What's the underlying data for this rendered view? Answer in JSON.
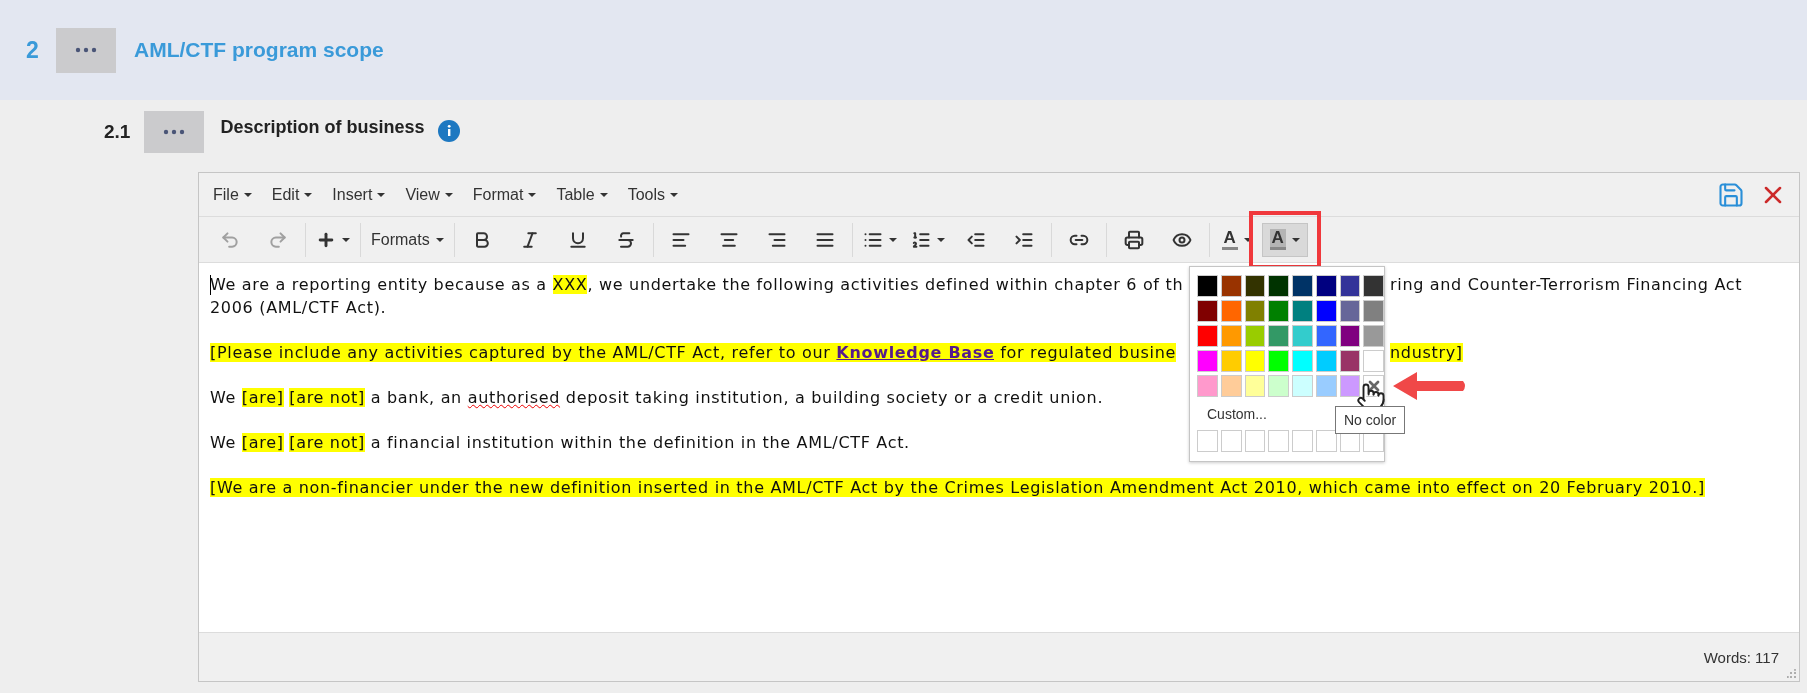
{
  "section": {
    "number": "2",
    "title": "AML/CTF program scope"
  },
  "subsection": {
    "number": "2.1",
    "title": "Description of business"
  },
  "editor": {
    "menus": [
      "File",
      "Edit",
      "Insert",
      "View",
      "Format",
      "Table",
      "Tools"
    ],
    "toolbar": [
      {
        "buttons": [
          {
            "kind": "undo",
            "disabled": true,
            "dropdown": false,
            "pressed": false
          },
          {
            "kind": "redo",
            "disabled": true,
            "dropdown": false,
            "pressed": false
          }
        ]
      },
      {
        "buttons": [
          {
            "kind": "insert",
            "disabled": false,
            "dropdown": true,
            "pressed": false
          }
        ]
      },
      {
        "buttons": [
          {
            "kind": "text",
            "label": "Formats",
            "disabled": false,
            "dropdown": true,
            "pressed": false
          }
        ]
      },
      {
        "buttons": [
          {
            "kind": "bold",
            "disabled": false,
            "dropdown": false,
            "pressed": false
          },
          {
            "kind": "italic",
            "disabled": false,
            "dropdown": false,
            "pressed": false
          },
          {
            "kind": "underline",
            "disabled": false,
            "dropdown": false,
            "pressed": false
          },
          {
            "kind": "strikethrough",
            "disabled": false,
            "dropdown": false,
            "pressed": false
          }
        ]
      },
      {
        "buttons": [
          {
            "kind": "align-left",
            "disabled": false,
            "dropdown": false,
            "pressed": false
          },
          {
            "kind": "align-center",
            "disabled": false,
            "dropdown": false,
            "pressed": false
          },
          {
            "kind": "align-right",
            "disabled": false,
            "dropdown": false,
            "pressed": false
          },
          {
            "kind": "justify",
            "disabled": false,
            "dropdown": false,
            "pressed": false
          }
        ]
      },
      {
        "buttons": [
          {
            "kind": "bullet-list",
            "disabled": false,
            "dropdown": true,
            "pressed": false
          },
          {
            "kind": "numbered-list",
            "disabled": false,
            "dropdown": true,
            "pressed": false
          },
          {
            "kind": "outdent",
            "disabled": false,
            "dropdown": false,
            "pressed": false
          },
          {
            "kind": "indent",
            "disabled": false,
            "dropdown": false,
            "pressed": false
          }
        ]
      },
      {
        "buttons": [
          {
            "kind": "link",
            "disabled": false,
            "dropdown": false,
            "pressed": false
          }
        ]
      },
      {
        "buttons": [
          {
            "kind": "print",
            "disabled": false,
            "dropdown": false,
            "pressed": false
          },
          {
            "kind": "preview",
            "disabled": false,
            "dropdown": false,
            "pressed": false
          }
        ]
      },
      {
        "buttons": [
          {
            "kind": "text-color",
            "label": "A",
            "disabled": false,
            "dropdown": true,
            "pressed": false
          },
          {
            "kind": "background-color",
            "label": "A",
            "disabled": false,
            "dropdown": true,
            "pressed": true
          }
        ]
      }
    ],
    "paragraphs": [
      {
        "lines": [
          [
            {
              "kind": "text",
              "text": "We are a reporting entity because as a "
            },
            {
              "kind": "mark",
              "text": "XXX"
            },
            {
              "kind": "text",
              "text": ", we undertake the following activities defined within chapter 6 of th"
            },
            {
              "kind": "covered"
            },
            {
              "kind": "text",
              "text": "ring and Counter-Terrorism Financing Act"
            }
          ],
          [
            {
              "kind": "text",
              "text": "2006 (AML/CTF Act)."
            }
          ]
        ]
      },
      {
        "lines": [
          [
            {
              "kind": "mark",
              "text": "[Please include any activities captured by the AML/CTF Act, refer to our "
            },
            {
              "kind": "link",
              "text": "Knowledge Base"
            },
            {
              "kind": "mark",
              "text": " for regulated busine"
            },
            {
              "kind": "covered"
            },
            {
              "kind": "mark",
              "text": "ndustry]"
            }
          ]
        ]
      },
      {
        "lines": [
          [
            {
              "kind": "text",
              "text": "We "
            },
            {
              "kind": "mark",
              "text": "[are]"
            },
            {
              "kind": "space"
            },
            {
              "kind": "mark",
              "text": "[are not]"
            },
            {
              "kind": "text",
              "text": " a bank, an "
            },
            {
              "kind": "misspelled",
              "text": "authorised"
            },
            {
              "kind": "text",
              "text": " deposit taking institution, a building society or a credit union."
            }
          ]
        ]
      },
      {
        "lines": [
          [
            {
              "kind": "text",
              "text": "We "
            },
            {
              "kind": "mark",
              "text": "[are]"
            },
            {
              "kind": "space"
            },
            {
              "kind": "mark",
              "text": "[are not]"
            },
            {
              "kind": "text",
              "text": " a financial institution within the definition in the AML/CTF Act."
            }
          ]
        ]
      },
      {
        "lines": [
          [
            {
              "kind": "mark",
              "text": "[We are a non-financier under the new definition inserted in the AML/CTF Act by the Crimes Legislation Amendment Act 2010, which came into effect on 20 February 2010.]"
            }
          ]
        ]
      }
    ],
    "color_picker": {
      "rows": [
        [
          {
            "kind": "color",
            "color": "#000000"
          },
          {
            "kind": "color",
            "color": "#993300"
          },
          {
            "kind": "color",
            "color": "#333300"
          },
          {
            "kind": "color",
            "color": "#003300"
          },
          {
            "kind": "color",
            "color": "#003366"
          },
          {
            "kind": "color",
            "color": "#000080"
          },
          {
            "kind": "color",
            "color": "#333399"
          },
          {
            "kind": "color",
            "color": "#333333"
          }
        ],
        [
          {
            "kind": "color",
            "color": "#800000"
          },
          {
            "kind": "color",
            "color": "#ff6600"
          },
          {
            "kind": "color",
            "color": "#808000"
          },
          {
            "kind": "color",
            "color": "#008000"
          },
          {
            "kind": "color",
            "color": "#008080"
          },
          {
            "kind": "color",
            "color": "#0000ff"
          },
          {
            "kind": "color",
            "color": "#666699"
          },
          {
            "kind": "color",
            "color": "#808080"
          }
        ],
        [
          {
            "kind": "color",
            "color": "#ff0000"
          },
          {
            "kind": "color",
            "color": "#ff9900"
          },
          {
            "kind": "color",
            "color": "#99cc00"
          },
          {
            "kind": "color",
            "color": "#339966"
          },
          {
            "kind": "color",
            "color": "#33cccc"
          },
          {
            "kind": "color",
            "color": "#3366ff"
          },
          {
            "kind": "color",
            "color": "#800080"
          },
          {
            "kind": "color",
            "color": "#999999"
          }
        ],
        [
          {
            "kind": "color",
            "color": "#ff00ff"
          },
          {
            "kind": "color",
            "color": "#ffcc00"
          },
          {
            "kind": "color",
            "color": "#ffff00"
          },
          {
            "kind": "color",
            "color": "#00ff00"
          },
          {
            "kind": "color",
            "color": "#00ffff"
          },
          {
            "kind": "color",
            "color": "#00ccff"
          },
          {
            "kind": "color",
            "color": "#993366"
          },
          {
            "kind": "color",
            "color": "#ffffff"
          }
        ],
        [
          {
            "kind": "color",
            "color": "#ff99cc"
          },
          {
            "kind": "color",
            "color": "#ffcc99"
          },
          {
            "kind": "color",
            "color": "#ffff99"
          },
          {
            "kind": "color",
            "color": "#ccffcc"
          },
          {
            "kind": "color",
            "color": "#ccffff"
          },
          {
            "kind": "color",
            "color": "#99ccff"
          },
          {
            "kind": "color",
            "color": "#cc99ff"
          },
          {
            "kind": "none"
          }
        ]
      ],
      "custom_label": "Custom...",
      "custom_swatches": [
        {
          "color": "#ffffff"
        },
        {
          "color": "#ffffff"
        },
        {
          "color": "#ffffff"
        },
        {
          "color": "#ffffff"
        },
        {
          "color": "#ffffff"
        },
        {
          "color": "#ffffff"
        },
        {
          "color": "#ffffff"
        },
        {
          "color": "#ffffff"
        }
      ],
      "tooltip": "No color"
    },
    "status": {
      "word_count": "Words: 117"
    }
  }
}
